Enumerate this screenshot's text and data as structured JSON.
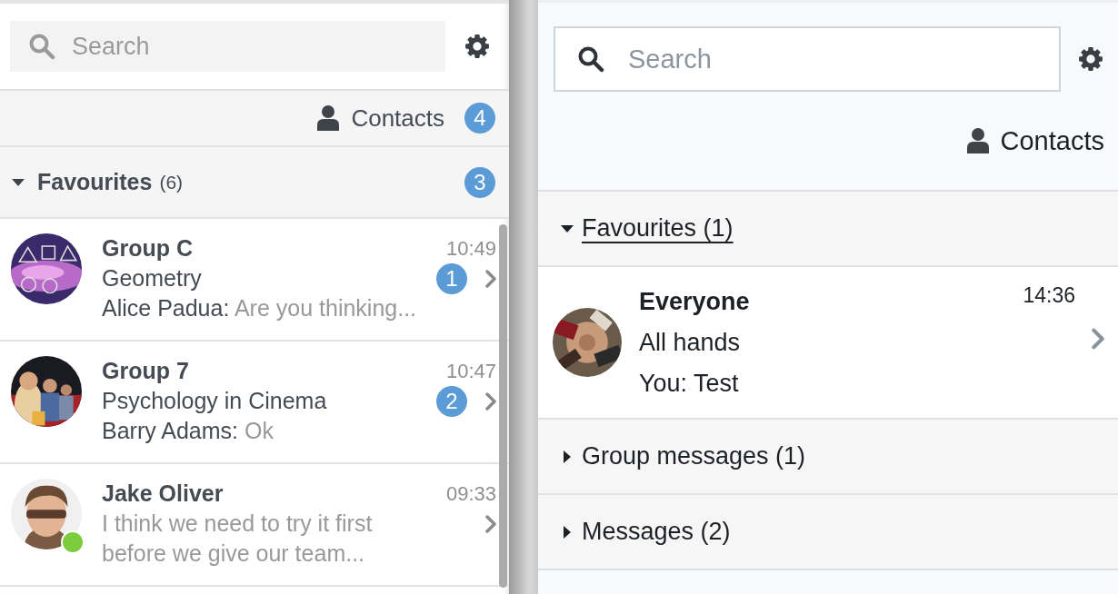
{
  "left_panel": {
    "search": {
      "placeholder": "Search"
    },
    "contacts": {
      "label": "Contacts",
      "badge": "4"
    },
    "section": {
      "title": "Favourites",
      "count": "(6)",
      "expanded": true,
      "badge": "3"
    },
    "conversations": [
      {
        "title": "Group C",
        "time": "10:49",
        "subtitle": "Geometry",
        "sender": "Alice Padua:",
        "preview": "Are you thinking...",
        "unread": "1",
        "online": false
      },
      {
        "title": "Group 7",
        "time": "10:47",
        "subtitle": "Psychology in Cinema",
        "sender": "Barry Adams:",
        "preview": "Ok",
        "unread": "2",
        "online": false
      },
      {
        "title": "Jake Oliver",
        "time": "09:33",
        "preview": "I think we need to try it first before we give our team...",
        "online": true
      }
    ]
  },
  "right_panel": {
    "search": {
      "placeholder": "Search"
    },
    "contacts": {
      "label": "Contacts"
    },
    "sections": [
      {
        "title": "Favourites (1)",
        "expanded": true,
        "focused": true,
        "conversations": [
          {
            "title": "Everyone",
            "time": "14:36",
            "subtitle": "All hands",
            "preview": "You: Test"
          }
        ]
      },
      {
        "title": "Group messages (1)",
        "expanded": false,
        "focused": false
      },
      {
        "title": "Messages (2)",
        "expanded": false,
        "focused": false
      }
    ]
  }
}
